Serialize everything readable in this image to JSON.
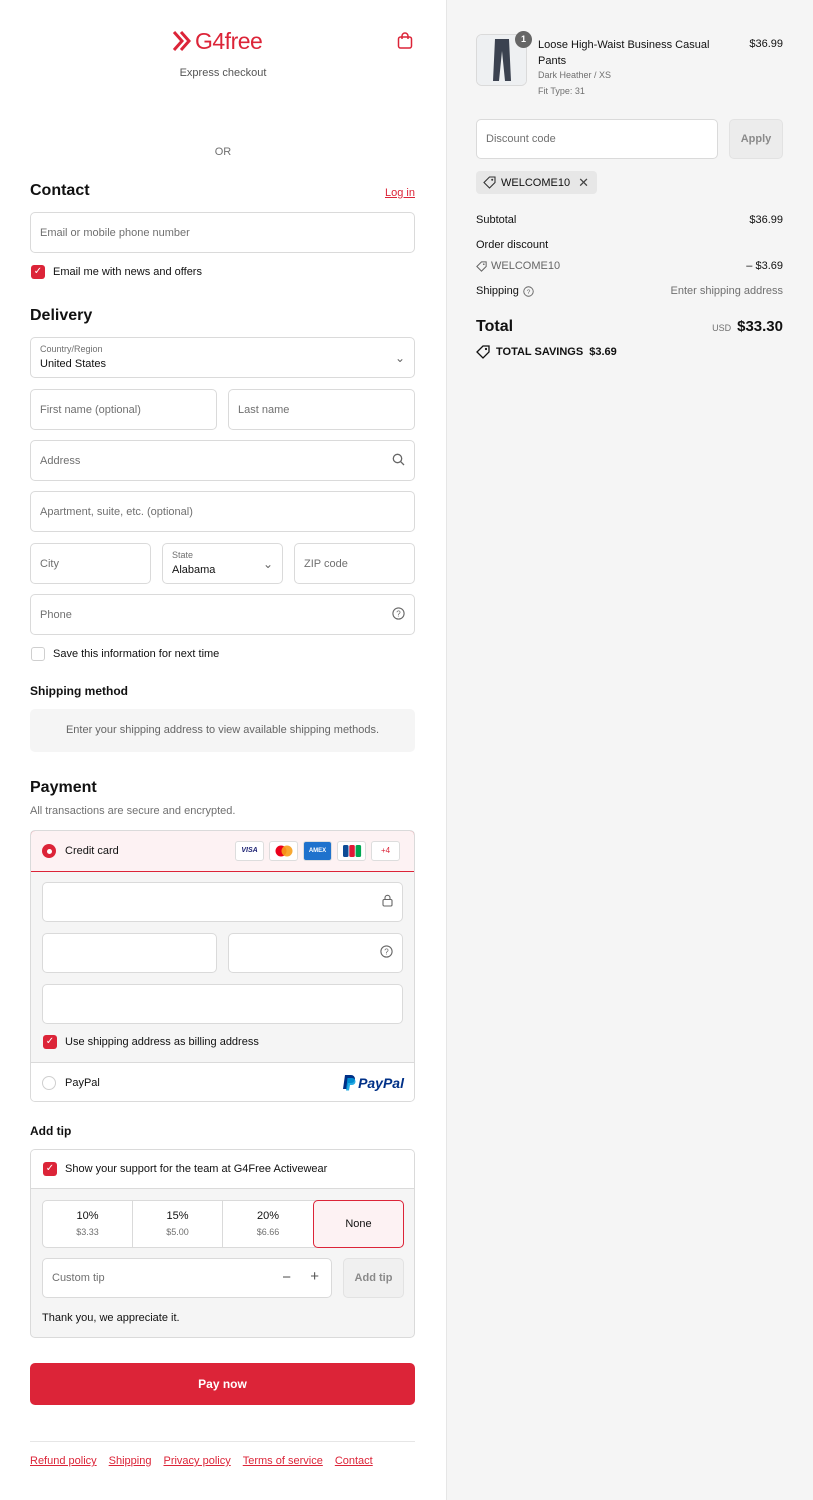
{
  "header": {
    "brand": "G4free",
    "express_checkout": "Express checkout",
    "or_label": "OR"
  },
  "contact": {
    "title": "Contact",
    "login_link": "Log in",
    "email_placeholder": "Email or mobile phone number",
    "newsletter_label": "Email me with news and offers",
    "newsletter_checked": true
  },
  "delivery": {
    "title": "Delivery",
    "country_label": "Country/Region",
    "country_value": "United States",
    "first_name_placeholder": "First name (optional)",
    "last_name_placeholder": "Last name",
    "address_placeholder": "Address",
    "apartment_placeholder": "Apartment, suite, etc. (optional)",
    "city_placeholder": "City",
    "state_label": "State",
    "state_value": "Alabama",
    "zip_placeholder": "ZIP code",
    "phone_placeholder": "Phone",
    "save_info_label": "Save this information for next time",
    "save_info_checked": false
  },
  "shipping_method": {
    "title": "Shipping method",
    "notice": "Enter your shipping address to view available shipping methods."
  },
  "payment": {
    "title": "Payment",
    "subtitle": "All transactions are secure and encrypted.",
    "credit_card_label": "Credit card",
    "card_brands": [
      "VISA",
      "Mastercard",
      "AMEX",
      "JCB"
    ],
    "more_cards": "+4",
    "billing_label": "Use shipping address as billing address",
    "billing_checked": true,
    "paypal_label": "PayPal",
    "paypal_logo": "PayPal"
  },
  "tip": {
    "title": "Add tip",
    "support_label": "Show your support for the team at G4Free Activewear",
    "support_checked": true,
    "options": [
      {
        "percent": "10%",
        "amount": "$3.33"
      },
      {
        "percent": "15%",
        "amount": "$5.00"
      },
      {
        "percent": "20%",
        "amount": "$6.66"
      }
    ],
    "none_label": "None",
    "custom_placeholder": "Custom tip",
    "add_tip_label": "Add tip",
    "thanks": "Thank you, we appreciate it."
  },
  "pay_now": "Pay now",
  "footer": {
    "links": [
      "Refund policy",
      "Shipping",
      "Privacy policy",
      "Terms of service",
      "Contact"
    ]
  },
  "summary": {
    "product": {
      "quantity": "1",
      "name": "Loose High-Waist Business Casual Pants",
      "variant": "Dark Heather / XS",
      "fit": "Fit Type: 31",
      "price": "$36.99"
    },
    "discount_placeholder": "Discount code",
    "apply_label": "Apply",
    "applied_code": "WELCOME10",
    "subtotal_label": "Subtotal",
    "subtotal_value": "$36.99",
    "order_discount_label": "Order discount",
    "discount_code": "WELCOME10",
    "discount_value": "– $3.69",
    "shipping_label": "Shipping",
    "shipping_value": "Enter shipping address",
    "total_label": "Total",
    "currency": "USD",
    "total_value": "$33.30",
    "savings_label": "TOTAL SAVINGS",
    "savings_value": "$3.69"
  },
  "colors": {
    "accent": "#dc2438",
    "summary_bg": "#f5f5f5"
  }
}
